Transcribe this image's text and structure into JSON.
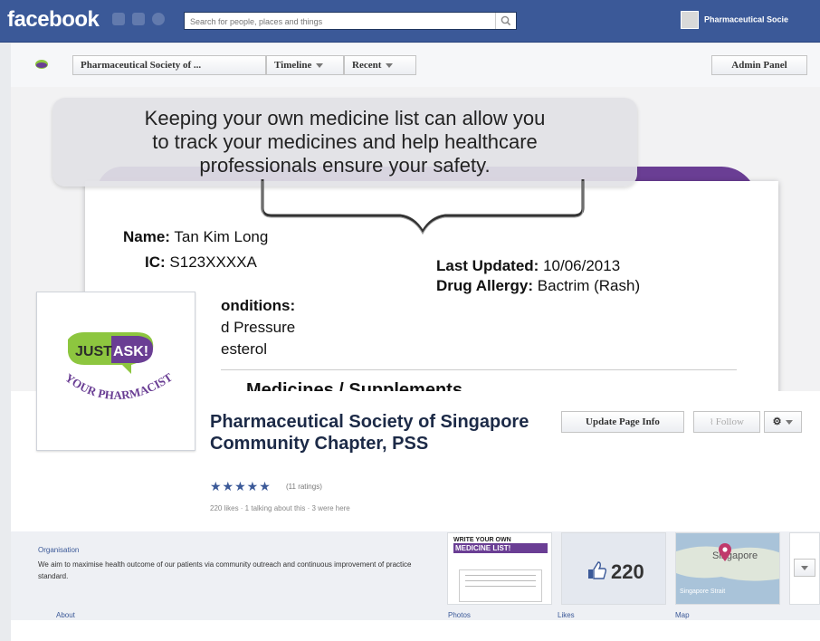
{
  "header": {
    "logo": "facebook",
    "search_placeholder": "Search for people, places and things",
    "page_switcher_label": "Pharmaceutical Socie"
  },
  "page_nav": {
    "page_name": "Pharmaceutical Society of ...",
    "timeline_label": "Timeline",
    "recent_label": "Recent",
    "admin_panel_label": "Admin Panel"
  },
  "cover": {
    "bubble_text_1": "Keeping your own medicine list can allow you",
    "bubble_text_2": "to track your medicines and help healthcare",
    "bubble_text_3": "professionals ensure your safety.",
    "name_label": "Name:",
    "name_value": "Tan Kim Long",
    "ic_label": "IC:",
    "ic_value": "S123XXXXA",
    "last_updated_label": "Last Updated:",
    "last_updated_value": "10/06/2013",
    "drug_allergy_label": "Drug Allergy:",
    "drug_allergy_value": "Bactrim (Rash)",
    "conditions_label": "onditions:",
    "condition_1": "d Pressure",
    "condition_2": "esterol",
    "partial_heading": "Medicines / Supplements"
  },
  "profile": {
    "logo_text_just": "JUST",
    "logo_text_ask": "ASK!",
    "logo_text_pharmacist": "YOUR PHARMACIST",
    "page_title": "Pharmaceutical Society of Singapore Community Chapter, PSS",
    "stars": "★★★★★",
    "ratings": "(11 ratings)",
    "stats": "220 likes · 1 talking about this · 3 were here",
    "update_info_label": "Update Page Info",
    "follow_label": "Follow",
    "gear_label": "⚙"
  },
  "about": {
    "category": "Organisation",
    "description": "We aim to maximise health outcome of our patients via community outreach and continuous improvement of practice standard.",
    "about_label": "About"
  },
  "apps": {
    "photos_label": "Photos",
    "photo_thumb_line1": "WRITE YOUR OWN",
    "photo_thumb_line2": "MEDICINE LIST!",
    "likes_count": "220",
    "likes_label": "Likes",
    "map_label": "Map",
    "map_text_1": "Singapore",
    "map_text_2": "Singapore Strait"
  },
  "colors": {
    "facebook_blue": "#3b5998",
    "cover_purple": "#6a3e94",
    "just_ask_green": "#8dc63f"
  }
}
